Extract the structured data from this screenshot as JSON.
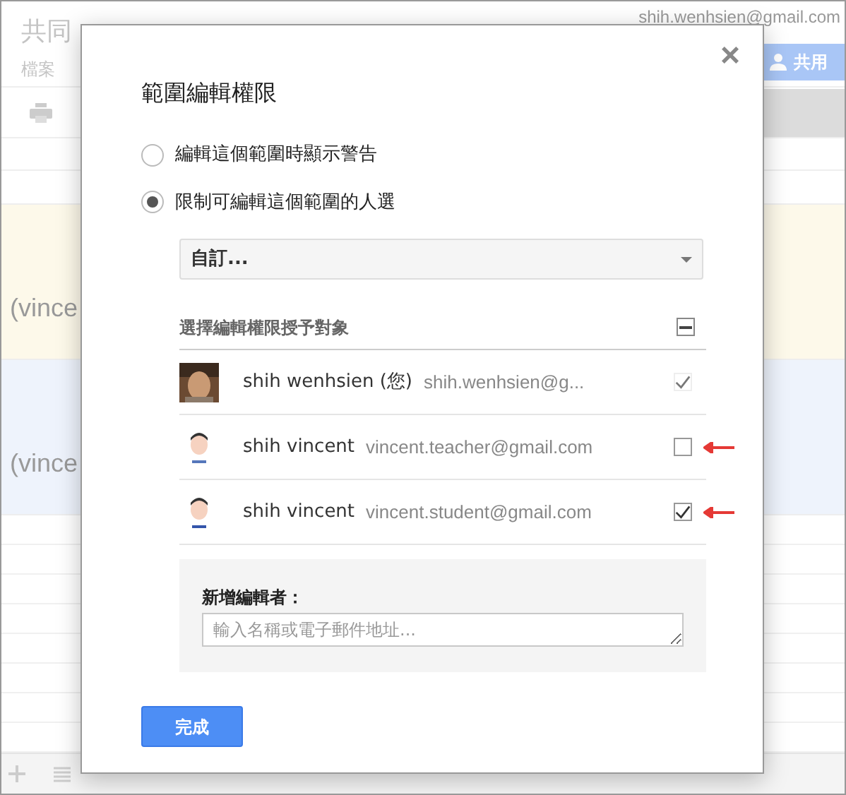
{
  "background": {
    "doc_title": "共同",
    "menu": "檔案",
    "account": "shih.wenhsien@gmail.com",
    "share_button": "共用",
    "cells": [
      {
        "text": "(vince",
        "color": "#fdf9ea"
      },
      {
        "text": "(vince",
        "color": "#eef3fc"
      }
    ]
  },
  "dialog": {
    "title": "範圍編輯權限",
    "close": "×",
    "options": [
      {
        "label": "編輯這個範圍時顯示警告",
        "selected": false
      },
      {
        "label": "限制可編輯這個範圍的人選",
        "selected": true
      }
    ],
    "dropdown": {
      "value": "自訂..."
    },
    "list_header": "選擇編輯權限授予對象",
    "header_indeterminate": true,
    "people": [
      {
        "name": "shih wenhsien (您)",
        "email": "shih.wenhsien@g...",
        "checked": true,
        "disabled": true,
        "annotated": false
      },
      {
        "name": "shih vincent",
        "email": "vincent.teacher@gmail.com",
        "checked": false,
        "disabled": false,
        "annotated": true
      },
      {
        "name": "shih vincent",
        "email": "vincent.student@gmail.com",
        "checked": true,
        "disabled": false,
        "annotated": true
      }
    ],
    "add_label": "新增編輯者：",
    "add_placeholder": "輸入名稱或電子郵件地址...",
    "done": "完成"
  }
}
